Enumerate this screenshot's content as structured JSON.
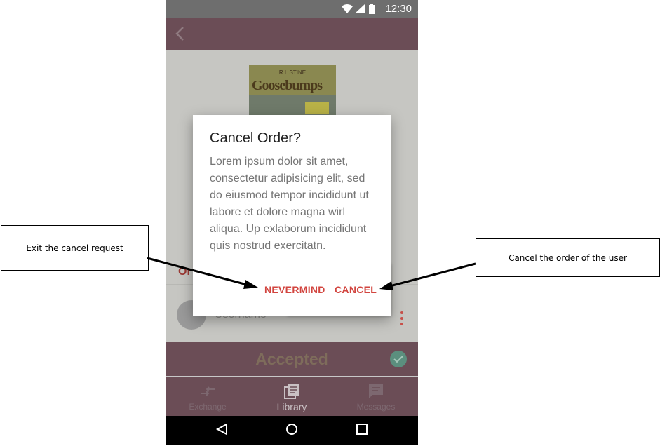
{
  "status_bar": {
    "time": "12:30"
  },
  "app_bar": {
    "back_icon": "arrow-back-icon"
  },
  "book": {
    "author": "R.L.STINE",
    "title": "Goosebumps"
  },
  "order_label": "Or",
  "user_row": {
    "username": "Username"
  },
  "popup_menu": {
    "item": "d"
  },
  "status_bar_bottom": {
    "label": "Accepted"
  },
  "bottom_nav": [
    {
      "label": "Exchange",
      "icon": "exchange-icon"
    },
    {
      "label": "Library",
      "icon": "library-icon"
    },
    {
      "label": "Messages",
      "icon": "message-icon"
    }
  ],
  "dialog": {
    "title": "Cancel Order?",
    "body": "Lorem ipsum dolor sit amet, consectetur adipisicing elit, sed do eiusmod tempor incididunt ut labore et dolore magna wirl aliqua. Up exlaborum incididunt quis nostrud exercitatn.",
    "nevermind_label": "NEVERMIND",
    "cancel_label": "CANCEL"
  },
  "annotations": {
    "left": "Exit the cancel request",
    "right": "Cancel the order of the user"
  },
  "colors": {
    "accent": "#d2453f",
    "app_bar": "#6b4d56",
    "accepted_check": "#5b8f7e"
  }
}
